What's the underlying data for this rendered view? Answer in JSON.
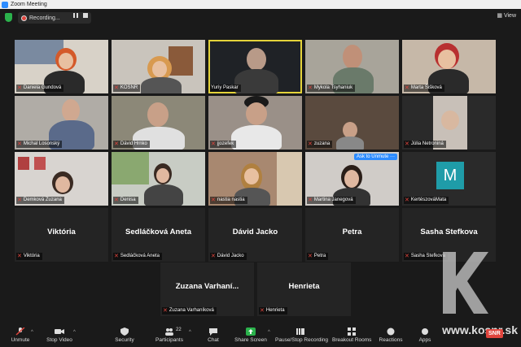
{
  "window": {
    "title": "Zoom Meeting"
  },
  "topbar": {
    "recording_label": "Recording...",
    "view_label": "View"
  },
  "participants_video": [
    {
      "name": "Daniela Gundová",
      "muted": true
    },
    {
      "name": "KOSNR",
      "muted": true
    },
    {
      "name": "Yuriy Paskar",
      "muted": false,
      "active_speaker": true
    },
    {
      "name": "Mykola Tsyhaniuk",
      "muted": true
    },
    {
      "name": "Marta Šišková",
      "muted": true
    },
    {
      "name": "Michal Losonský",
      "muted": true
    },
    {
      "name": "Dávid Hrnko",
      "muted": true
    },
    {
      "name": "jjozefek",
      "muted": true
    },
    {
      "name": "zuzana",
      "muted": true
    },
    {
      "name": "Júlia Netroniná",
      "muted": true
    },
    {
      "name": "Demková Zuzana",
      "muted": true
    },
    {
      "name": "Denisa",
      "muted": true
    },
    {
      "name": "nastia nastia",
      "muted": true
    },
    {
      "name": "Martina Janegová",
      "muted": true,
      "ask_to_unmute": "Ask to Unmute"
    },
    {
      "name": "KertészováMata",
      "muted": true,
      "avatar_letter": "M"
    }
  ],
  "participants_noVideo": [
    {
      "display": "Viktória",
      "name": "Viktória"
    },
    {
      "display": "Sedláčková Aneta",
      "name": "Sedláčková Aneta"
    },
    {
      "display": "Dávid Jacko",
      "name": "Dávid Jacko"
    },
    {
      "display": "Petra",
      "name": "Petra"
    },
    {
      "display": "Sasha Stefkova",
      "name": "Sasha Stefkova"
    },
    {
      "display": "Zuzana Varhaní...",
      "name": "Zuzana Varhaníková"
    },
    {
      "display": "Henrieta",
      "name": "Henrieta"
    }
  ],
  "toolbar": {
    "unmute": "Unmute",
    "stop_video": "Stop Video",
    "security": "Security",
    "participants": "Participants",
    "participants_count": "22",
    "chat": "Chat",
    "share_screen": "Share Screen",
    "pause_stop_recording": "Pause/Stop Recording",
    "breakout_rooms": "Breakout Rooms",
    "reactions": "Reactions",
    "apps": "Apps"
  },
  "watermark": {
    "text": "www.kosnr.sk",
    "badge": "SNR"
  },
  "colors": {
    "active_speaker": "#e4d33a",
    "muted_mic": "#e0443c",
    "share_green": "#2bb24c",
    "ask_unmute": "#2d8cff",
    "avatar_teal": "#1f9ca8"
  }
}
